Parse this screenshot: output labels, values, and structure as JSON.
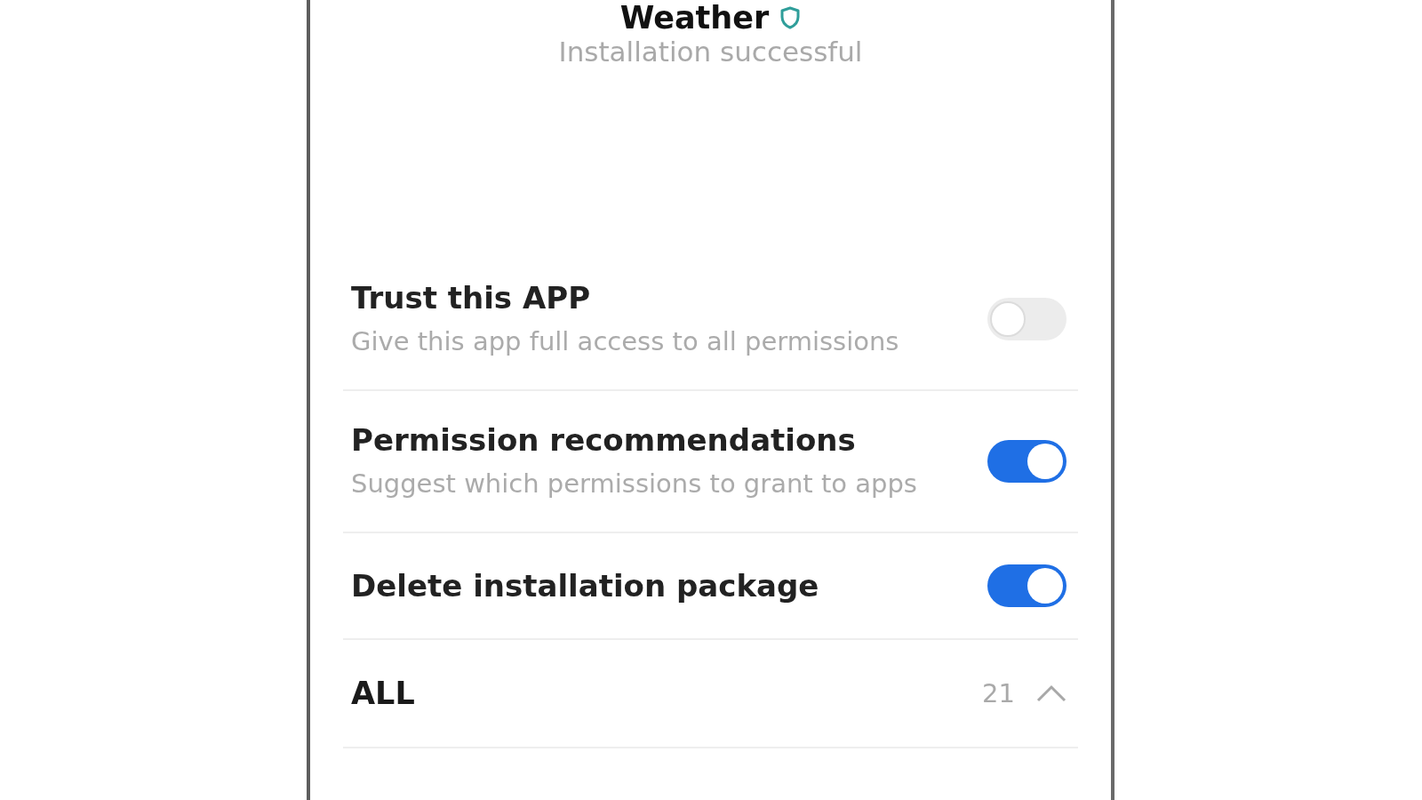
{
  "app": {
    "name": "Weather",
    "status": "Installation successful"
  },
  "settings": [
    {
      "title": "Trust this APP",
      "description": "Give this app full access to all permissions",
      "on": false
    },
    {
      "title": "Permission recommendations",
      "description": "Suggest which permissions to grant to apps",
      "on": true
    },
    {
      "title": "Delete installation package",
      "on": true
    }
  ],
  "permission_group": {
    "label": "ALL",
    "count": "21",
    "expanded": true
  }
}
